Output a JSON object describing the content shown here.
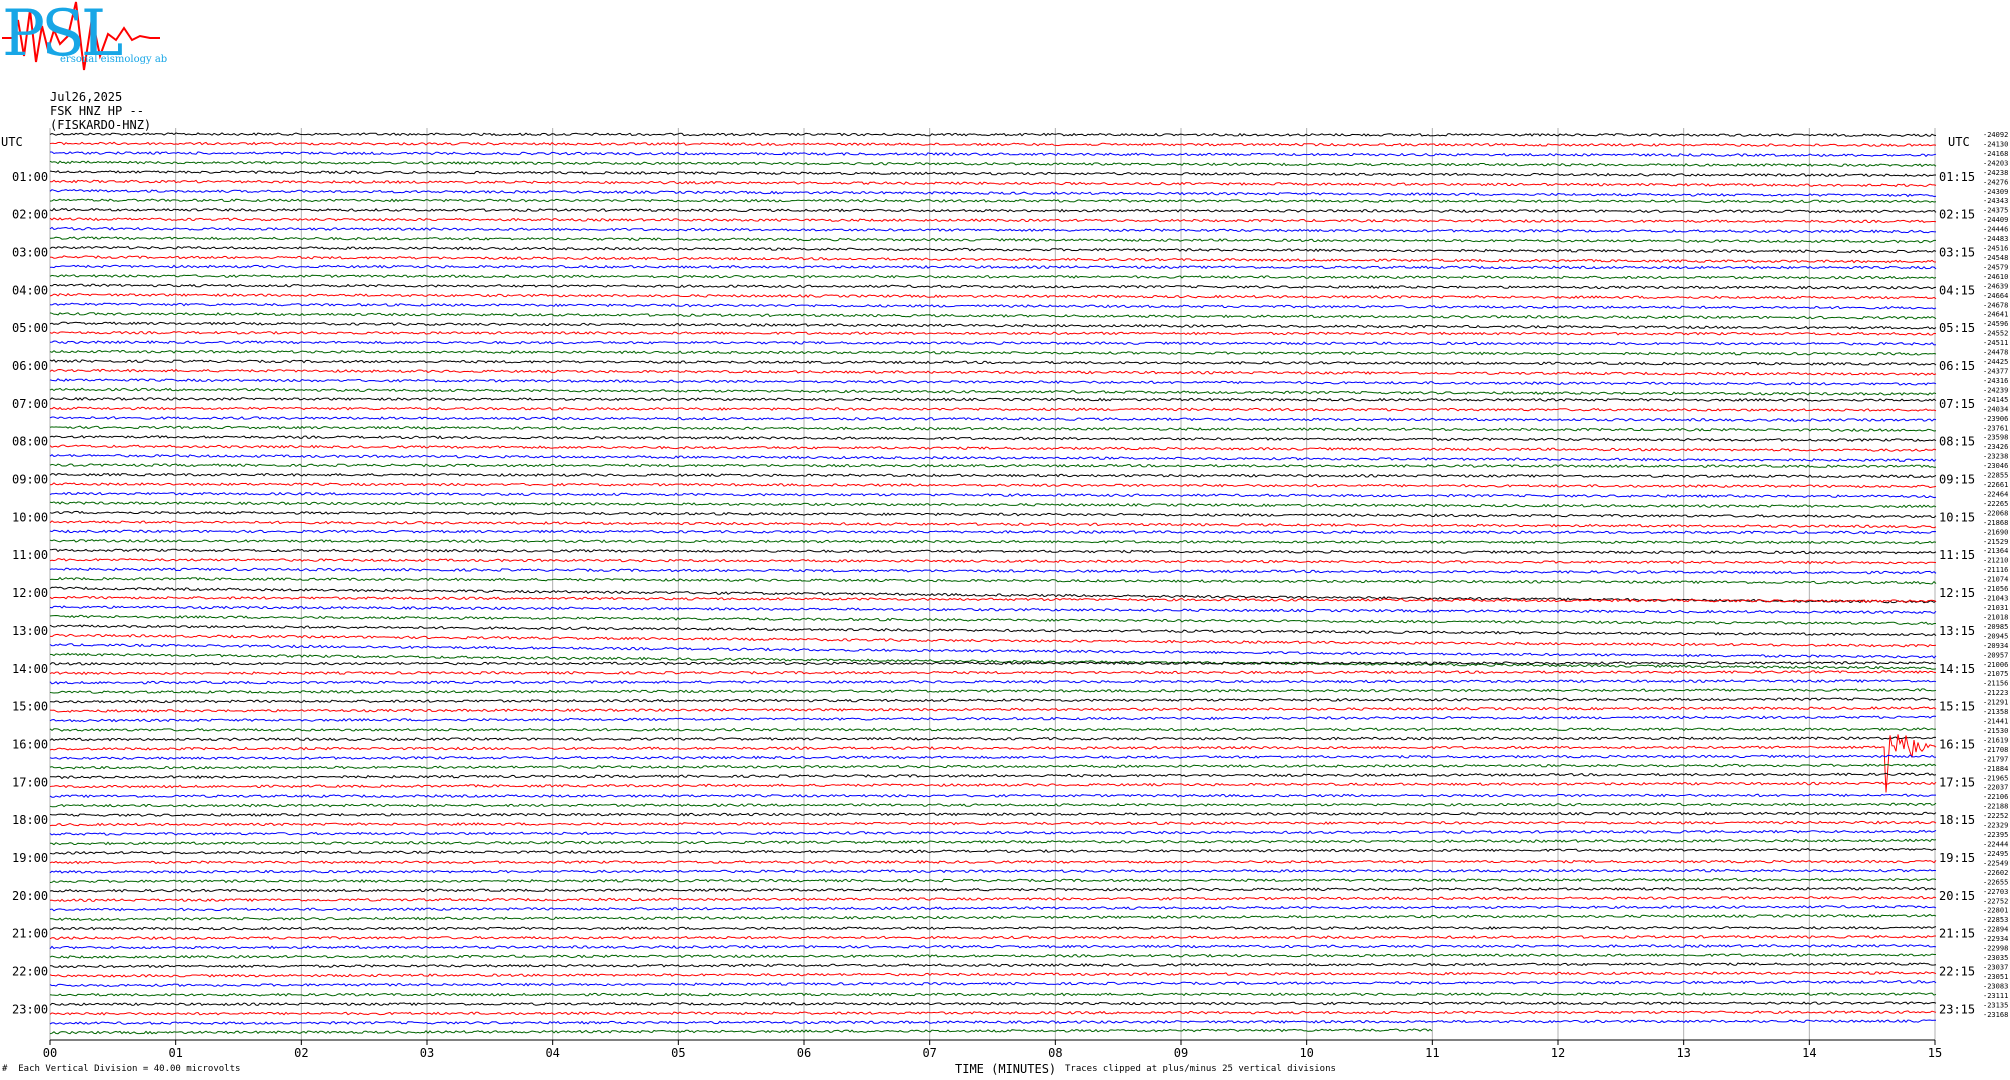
{
  "logo": {
    "letters": "PSL",
    "subtitle": "ersonal   eismology    ab",
    "colors": {
      "text": "#17a6e6",
      "signal": "#ff0000"
    }
  },
  "header": {
    "date": "Jul26,2025",
    "station": "FSK HNZ HP --",
    "location": "(FISKARDO-HNZ)"
  },
  "footer": {
    "mark": "#",
    "vertical_division": "Each Vertical Division =   40.00 microvolts",
    "xlabel": "TIME (MINUTES)",
    "clip_note": "Traces clipped at plus/minus 25 vertical divisions"
  },
  "chart_data": {
    "type": "line",
    "description_kind": "helicorder",
    "trace_colors": [
      "#000000",
      "#ff0000",
      "#0000ff",
      "#006400"
    ],
    "x_ticks": [
      "00",
      "01",
      "02",
      "03",
      "04",
      "05",
      "06",
      "07",
      "08",
      "09",
      "10",
      "11",
      "12",
      "13",
      "14",
      "15"
    ],
    "xlim": [
      0,
      15
    ],
    "left_axis": {
      "title": "UTC",
      "labels": [
        "01:00",
        "02:00",
        "03:00",
        "04:00",
        "05:00",
        "06:00",
        "07:00",
        "08:00",
        "09:00",
        "10:00",
        "11:00",
        "12:00",
        "13:00",
        "14:00",
        "15:00",
        "16:00",
        "17:00",
        "18:00",
        "19:00",
        "20:00",
        "21:00",
        "22:00",
        "23:00"
      ]
    },
    "right_axis": {
      "title": "UTC",
      "labels": [
        "01:15",
        "02:15",
        "03:15",
        "04:15",
        "05:15",
        "06:15",
        "07:15",
        "08:15",
        "09:15",
        "10:15",
        "11:15",
        "12:15",
        "13:15",
        "14:15",
        "15:15",
        "16:15",
        "17:15",
        "18:15",
        "19:15",
        "20:15",
        "21:15",
        "22:15",
        "23:15"
      ]
    },
    "trace_offsets": [
      "-24092",
      "-24130",
      "-24168",
      "-24203",
      "-24238",
      "-24276",
      "-24309",
      "-24343",
      "-24375",
      "-24409",
      "-24446",
      "-24483",
      "-24516",
      "-24548",
      "-24579",
      "-24610",
      "-24639",
      "-24664",
      "-24678",
      "-24641",
      "-24596",
      "-24552",
      "-24511",
      "-24478",
      "-24425",
      "-24377",
      "-24316",
      "-24239",
      "-24145",
      "-24034",
      "-23906",
      "-23761",
      "-23598",
      "-23426",
      "-23238",
      "-23046",
      "-22855",
      "-22661",
      "-22464",
      "-22265",
      "-22068",
      "-21868",
      "-21690",
      "-21529",
      "-21364",
      "-21210",
      "-21116",
      "-21074",
      "-21056",
      "-21043",
      "-21031",
      "-21018",
      "-20985",
      "-20945",
      "-20934",
      "-20957",
      "-21006",
      "-21075",
      "-21156",
      "-21223",
      "-21291",
      "-21358",
      "-21441",
      "-21530",
      "-21619",
      "-21708",
      "-21797",
      "-21884",
      "-21965",
      "-22037",
      "-22106",
      "-22188",
      "-22252",
      "-22329",
      "-22395",
      "-22444",
      "-22495",
      "-22549",
      "-22602",
      "-22655",
      "-22703",
      "-22752",
      "-22801",
      "-22853",
      "-22894",
      "-22934",
      "-22998",
      "-23035",
      "-23037",
      "-23051",
      "-23083",
      "-23111",
      "-23135",
      "-23168"
    ],
    "rows": 96,
    "last_row_end_minute": 11.0,
    "event": {
      "row": 65,
      "start_minute": 14.6,
      "end_minute": 15.0,
      "color": "#ff0000"
    }
  }
}
